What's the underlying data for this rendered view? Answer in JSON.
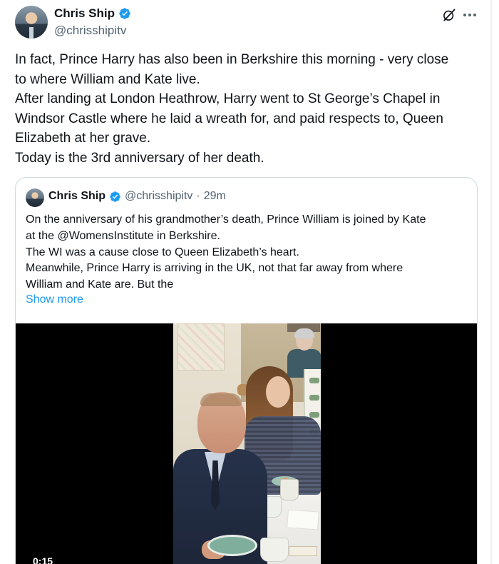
{
  "author": {
    "display_name": "Chris Ship",
    "handle": "@chrisshipitv",
    "verified": true
  },
  "icons": {
    "header_actions": [
      "grok-icon",
      "more-icon"
    ],
    "verified_color": "#1d9bf0"
  },
  "tweet": {
    "lines": [
      "In fact, Prince Harry has also been in Berkshire this morning - very close",
      "to where William and Kate live.",
      "After landing at London Heathrow, Harry went to St George’s Chapel in",
      "Windsor Castle where he laid a wreath for, and paid respects to, Queen",
      "Elizabeth at her grave.",
      "Today is the 3rd anniversary of her death."
    ]
  },
  "quote": {
    "display_name": "Chris Ship",
    "handle": "@chrisshipitv",
    "separator": "·",
    "time": "29m",
    "lines": [
      "On the anniversary of his grandmother’s death, Prince William is joined by Kate",
      "at the @WomensInstitute in Berkshire.",
      "The WI was a cause close to Queen Elizabeth’s heart.",
      "Meanwhile, Prince Harry is arriving in the UK, not that far away from where",
      "William and Kate are. But the"
    ],
    "show_more_label": "Show more",
    "media": {
      "type": "video",
      "timestamp": "0:15"
    }
  },
  "colors": {
    "text": "#0f1419",
    "secondary": "#536471",
    "link": "#1d9bf0",
    "border": "#cfd9de"
  }
}
